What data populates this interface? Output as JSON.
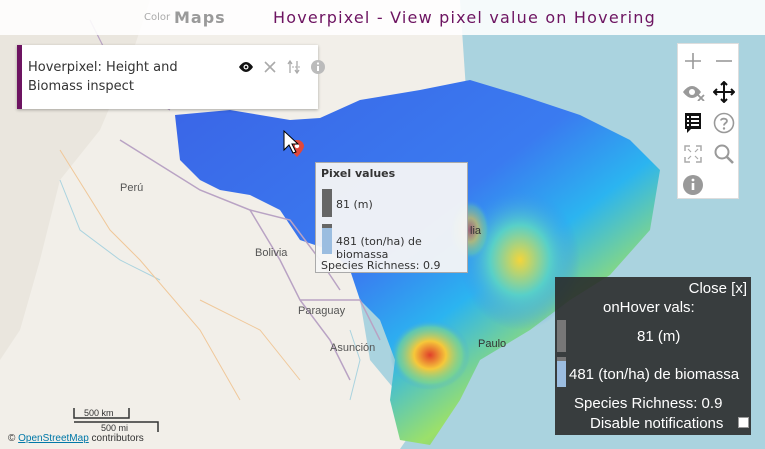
{
  "header": {
    "app_title": "Maps",
    "partial_label": "Color",
    "page_title": "Hoverpixel - View pixel value on Hovering"
  },
  "layer": {
    "name": "Hoverpixel: Height and Biomass inspect",
    "tools": [
      "eye-icon",
      "close-icon",
      "arrange-icon",
      "info-icon"
    ]
  },
  "tools": [
    "zoom-in-icon",
    "zoom-out-icon",
    "hide-icon",
    "pan-icon",
    "list-icon",
    "help-icon",
    "fullscreen-icon",
    "search-icon",
    "info-icon"
  ],
  "popup": {
    "title": "Pixel values",
    "height_value": "81 (m)",
    "biomass_value": "481 (ton/ha) de biomassa",
    "species": "Species Richness: 0.9"
  },
  "hover_panel": {
    "close": "Close [x]",
    "heading": "onHover vals:",
    "height_value": "81 (m)",
    "biomass_value": "481 (ton/ha) de biomassa",
    "species": "Species Richness: 0.9",
    "disable": "Disable notifications"
  },
  "map_labels": {
    "peru": "Perú",
    "bolivia": "Bolivia",
    "paraguay": "Paraguay",
    "asuncion": "Asunción",
    "paulo": "Paulo",
    "lia": "lia"
  },
  "scale": {
    "km": "500 km",
    "mi": "500 mi"
  },
  "attribution": {
    "prefix": "©",
    "link": "OpenStreetMap",
    "suffix": "contributors"
  },
  "colors": {
    "accent": "#6d1461",
    "popup_bar_height": "#666666",
    "popup_bar_biomass": "#9bbde0"
  }
}
